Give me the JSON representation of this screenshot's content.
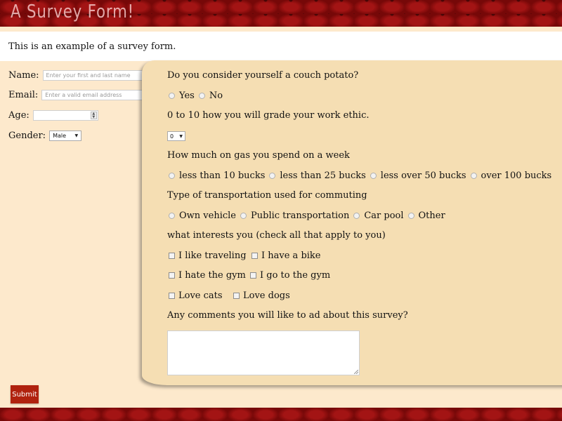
{
  "header": {
    "title": "A Survey Form!"
  },
  "intro": {
    "text": "This is an example of a survey form."
  },
  "personal": {
    "name_label": "Name:",
    "name_placeholder": "Enter your first and last name",
    "email_label": "Email:",
    "email_placeholder": "Enter a valid email address",
    "age_label": "Age:",
    "age_value": "",
    "gender_label": "Gender:",
    "gender_value": "Male"
  },
  "questions": {
    "q1": {
      "text": "Do you consider yourself a couch potato?",
      "options": [
        "Yes",
        "No"
      ]
    },
    "q2": {
      "text": "0 to 10 how you will grade your work ethic.",
      "value": "0"
    },
    "q3": {
      "text": "How much on gas you spend on a week",
      "options": [
        "less than 10 bucks",
        "less than 25 bucks",
        "less over 50 bucks",
        "over 100 bucks"
      ]
    },
    "q4": {
      "text": "Type of transportation used for commuting",
      "options": [
        "Own vehicle",
        "Public transportation",
        "Car pool",
        "Other"
      ]
    },
    "q5": {
      "text": "what interests you (check all that apply to you)",
      "options": [
        "I like traveling",
        "I have a bike",
        "I hate the gym",
        "I go to the gym",
        "Love cats",
        "Love dogs"
      ]
    },
    "q6": {
      "text": "Any comments you will like to ad about this survey?",
      "value": ""
    }
  },
  "submit": {
    "label": "Submit"
  },
  "colors": {
    "banner": "#8c0b0b",
    "page_bg": "#fde9cc",
    "panel_bg": "#f5deb3",
    "submit_bg": "#b0220e"
  }
}
